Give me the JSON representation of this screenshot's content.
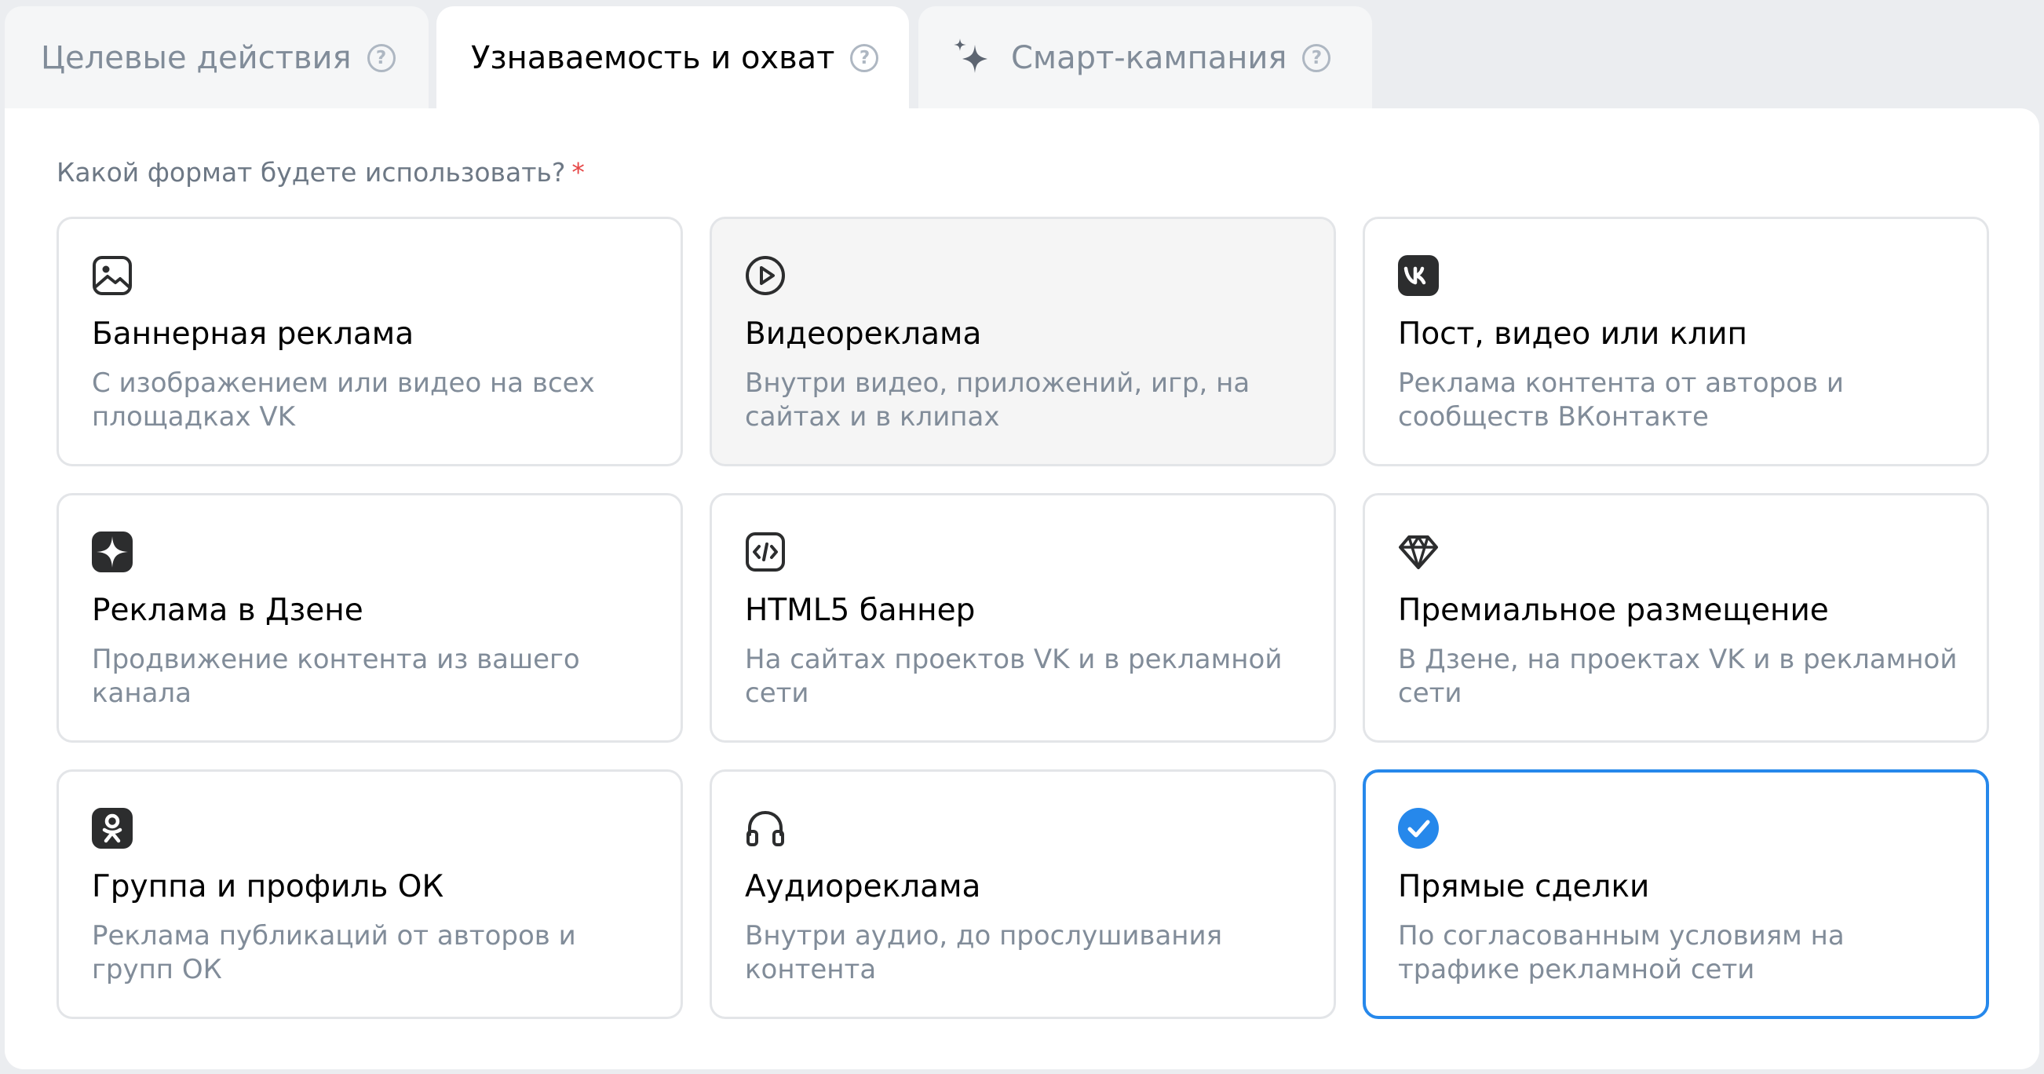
{
  "tabs": [
    {
      "label": "Целевые действия",
      "active": false
    },
    {
      "label": "Узнаваемость и охват",
      "active": true
    },
    {
      "label": "Смарт-кампания",
      "active": false
    }
  ],
  "form": {
    "question": "Какой формат будете использовать?",
    "required_mark": "*"
  },
  "formats": [
    {
      "icon": "image-icon",
      "title": "Баннерная реклама",
      "description": "С изображением или видео на всех площадках VK"
    },
    {
      "icon": "play-circle-icon",
      "title": "Видеореклама",
      "description": "Внутри видео, приложений, игр, на сайтах и в клипах"
    },
    {
      "icon": "vk-logo-icon",
      "title": "Пост, видео или клип",
      "description": "Реклама контента от авторов и сообществ ВКонтакте"
    },
    {
      "icon": "dzen-logo-icon",
      "title": "Реклама в Дзене",
      "description": "Продвижение контента из вашего канала"
    },
    {
      "icon": "code-icon",
      "title": "HTML5 баннер",
      "description": "На сайтах проектов VK и в рекламной сети"
    },
    {
      "icon": "diamond-icon",
      "title": "Премиальное размещение",
      "description": "В Дзене, на проектах VK и в рекламной сети"
    },
    {
      "icon": "ok-logo-icon",
      "title": "Группа и профиль ОК",
      "description": "Реклама публикаций от авторов и групп ОК"
    },
    {
      "icon": "headphones-icon",
      "title": "Аудиореклама",
      "description": "Внутри аудио, до прослушивания контента"
    },
    {
      "icon": "check-circle-icon",
      "title": "Прямые сделки",
      "description": "По согласованным условиям на трафике рекламной сети"
    }
  ],
  "selected_format": "Прямые сделки",
  "colors": {
    "accent": "#2688eb",
    "text_secondary": "#818c99",
    "required": "#e64646"
  }
}
